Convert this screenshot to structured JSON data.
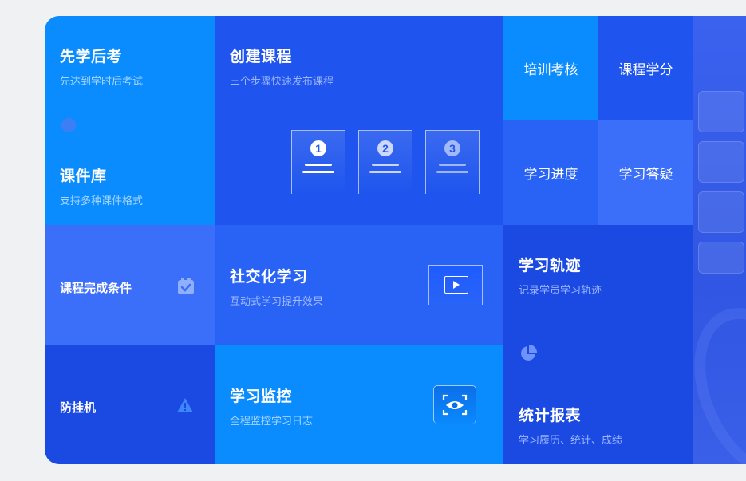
{
  "tiles": {
    "learn_first": {
      "title": "先学后考",
      "subtitle": "先达到学时后考试"
    },
    "courseware": {
      "title": "课件库",
      "subtitle": "支持多种课件格式"
    },
    "create_course": {
      "title": "创建课程",
      "subtitle": "三个步骤快速发布课程",
      "steps": [
        "1",
        "2",
        "3"
      ]
    },
    "training_exam": {
      "label": "培训考核"
    },
    "course_credit": {
      "label": "课程学分"
    },
    "progress": {
      "label": "学习进度"
    },
    "qa": {
      "label": "学习答疑"
    },
    "completion": {
      "label": "课程完成条件"
    },
    "social": {
      "title": "社交化学习",
      "subtitle": "互动式学习提升效果"
    },
    "trajectory": {
      "title": "学习轨迹",
      "subtitle": "记录学员学习轨迹"
    },
    "anti_idle": {
      "label": "防挂机"
    },
    "monitor": {
      "title": "学习监控",
      "subtitle": "全程监控学习日志"
    },
    "reports": {
      "title": "统计报表",
      "subtitle": "学习履历、统计、成绩"
    }
  },
  "icons": {
    "completion": "clipboard-check-icon",
    "anti_idle": "warning-icon",
    "social": "video-play-icon",
    "monitor": "eye-scan-icon",
    "reports": "pie-chart-icon",
    "learn_first": "small-circle-icon"
  },
  "colors": {
    "light_blue": "#0a8cff",
    "blue": "#1f55ee",
    "periwinkle": "#3b6ef9",
    "dark_blue": "#1b4ae3"
  }
}
